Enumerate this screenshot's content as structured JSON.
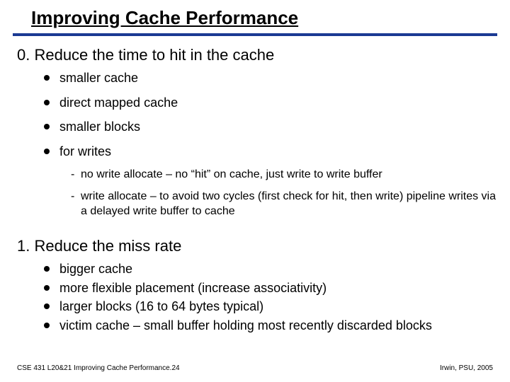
{
  "title": "Improving Cache Performance",
  "sections": [
    {
      "heading": "0. Reduce the time to hit in the cache",
      "bullets": [
        "smaller cache",
        "direct mapped cache",
        "smaller blocks",
        "for writes"
      ],
      "sub": [
        "no write allocate – no “hit” on cache, just write to write buffer",
        "write allocate – to avoid two cycles (first check for hit, then write) pipeline writes via a delayed write buffer to cache"
      ]
    },
    {
      "heading": "1. Reduce the miss rate",
      "bullets": [
        "bigger cache",
        "more flexible placement (increase associativity)",
        "larger blocks (16 to 64 bytes typical)",
        "victim cache – small buffer holding most recently discarded blocks"
      ]
    }
  ],
  "footer": {
    "left": "CSE 431  L20&21 Improving Cache Performance.24",
    "right": "Irwin, PSU, 2005"
  }
}
